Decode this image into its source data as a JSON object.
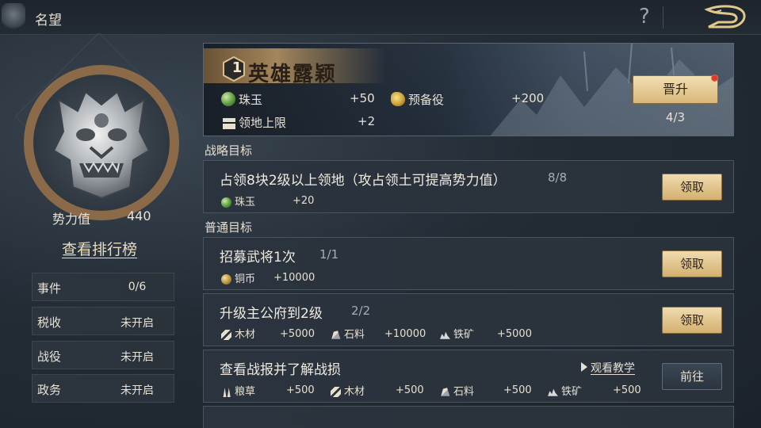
{
  "header": {
    "title": "名望",
    "help_glyph": "?"
  },
  "left_panel": {
    "power_label": "势力值",
    "power_value": "440",
    "ranking_link": "查看排行榜",
    "stats": [
      {
        "label": "事件",
        "value": "0/6"
      },
      {
        "label": "税收",
        "value": "未开启"
      },
      {
        "label": "战役",
        "value": "未开启"
      },
      {
        "label": "政务",
        "value": "未开启"
      }
    ]
  },
  "banner": {
    "level": "1",
    "title": "英雄露颖",
    "rewards": [
      {
        "icon": "jade-icon",
        "name": "珠玉",
        "amount": "+50"
      },
      {
        "icon": "reserve-troops-icon",
        "name": "预备役",
        "amount": "+200"
      },
      {
        "icon": "territory-icon",
        "name": "领地上限",
        "amount": "+2"
      }
    ],
    "promote_label": "晋升",
    "promote_progress": "4/3"
  },
  "strategic": {
    "section_label": "战略目标",
    "card": {
      "title": "占领8块2级以上领地（攻占领土可提高势力值）",
      "progress": "8/8",
      "reward_name": "珠玉",
      "reward_amount": "+20",
      "button": "领取"
    }
  },
  "normal": {
    "section_label": "普通目标",
    "cards": [
      {
        "title": "招募武将1次",
        "progress": "1/1",
        "rewards": [
          {
            "icon": "copper-coin-icon",
            "name": "铜币",
            "amount": "+10000"
          }
        ],
        "button": "领取"
      },
      {
        "title": "升级主公府到2级",
        "progress": "2/2",
        "rewards": [
          {
            "icon": "wood-icon",
            "name": "木材",
            "amount": "+5000"
          },
          {
            "icon": "stone-icon",
            "name": "石料",
            "amount": "+10000"
          },
          {
            "icon": "iron-ore-icon",
            "name": "铁矿",
            "amount": "+5000"
          }
        ],
        "button": "领取"
      },
      {
        "title": "查看战报并了解战损",
        "tutorial": "观看教学",
        "rewards": [
          {
            "icon": "grain-icon",
            "name": "粮草",
            "amount": "+500"
          },
          {
            "icon": "wood-icon",
            "name": "木材",
            "amount": "+500"
          },
          {
            "icon": "stone-icon",
            "name": "石料",
            "amount": "+500"
          },
          {
            "icon": "iron-ore-icon",
            "name": "铁矿",
            "amount": "+500"
          }
        ],
        "button": "前往"
      }
    ]
  },
  "colors": {
    "accent_gold": "#d8b878",
    "notification_red": "#e23a2a",
    "background": "#232c35"
  }
}
